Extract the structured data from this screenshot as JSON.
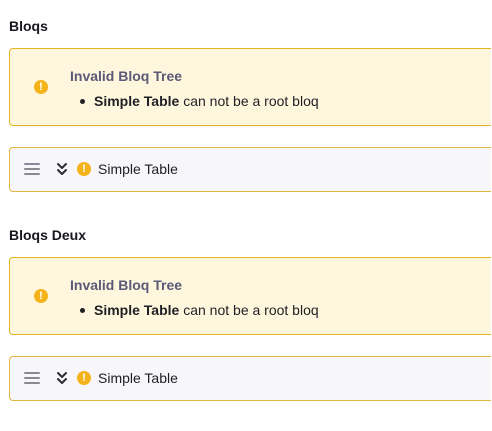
{
  "sections": [
    {
      "title": "Bloqs",
      "alert": {
        "icon": "warning-icon",
        "title": "Invalid Bloq Tree",
        "error_bloq": "Simple Table",
        "error_text": " can not be a root bloq"
      },
      "bloq": {
        "name": "Simple Table",
        "status_icon": "warning-icon"
      }
    },
    {
      "title": "Bloqs Deux",
      "alert": {
        "icon": "warning-icon",
        "title": "Invalid Bloq Tree",
        "error_bloq": "Simple Table",
        "error_text": " can not be a root bloq"
      },
      "bloq": {
        "name": "Simple Table",
        "status_icon": "warning-icon"
      }
    }
  ],
  "colors": {
    "warning": "#f5b31b",
    "alert_bg": "#fff7dd",
    "alert_border": "#e6b325",
    "row_bg": "#f6f6fb"
  }
}
